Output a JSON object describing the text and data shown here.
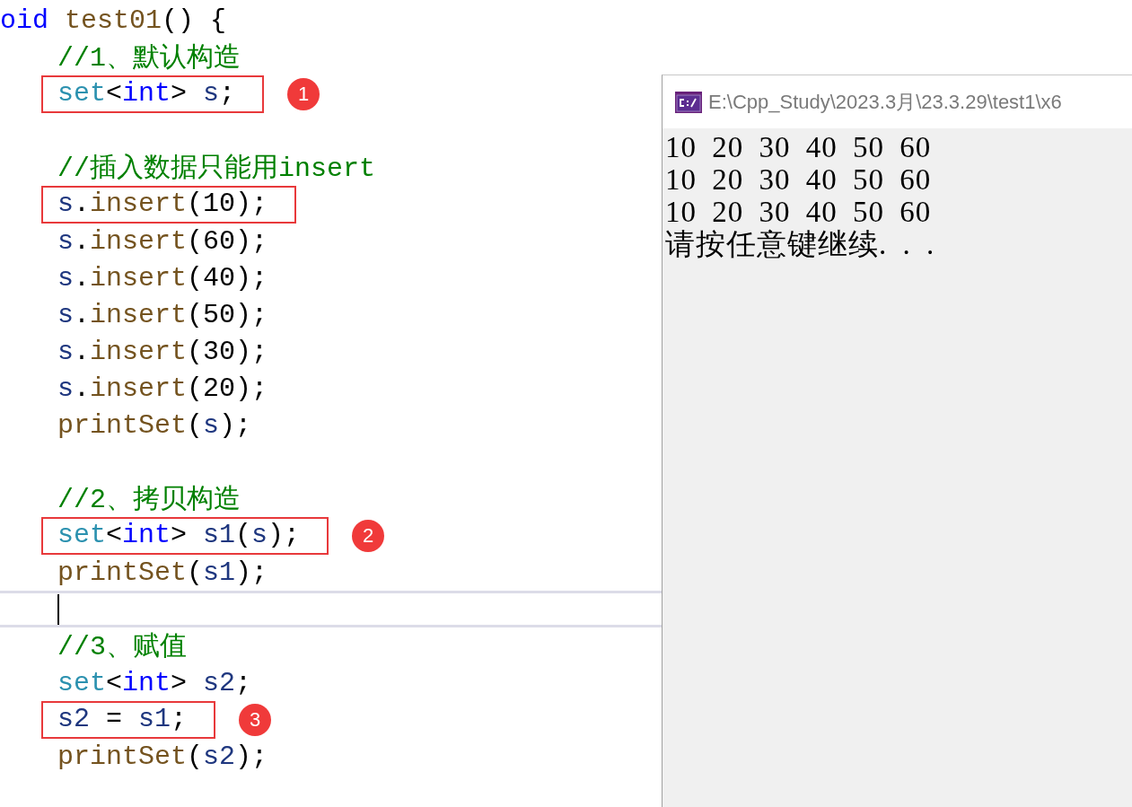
{
  "editor": {
    "lines": [
      {
        "boxed": false,
        "current": false,
        "tokens": [
          {
            "kind": "keyword",
            "text": "oid"
          },
          {
            "kind": "function",
            "text": " test01"
          },
          {
            "kind": "plain",
            "text": "() {"
          }
        ]
      },
      {
        "boxed": false,
        "current": false,
        "tokens": [
          {
            "kind": "comment",
            "text": "//1、默认构造"
          }
        ]
      },
      {
        "boxed": true,
        "current": false,
        "badge": "1",
        "tokens": [
          {
            "kind": "type",
            "text": "set"
          },
          {
            "kind": "plain",
            "text": "<"
          },
          {
            "kind": "keyword",
            "text": "int"
          },
          {
            "kind": "plain",
            "text": "> "
          },
          {
            "kind": "variable",
            "text": "s"
          },
          {
            "kind": "plain",
            "text": ";"
          }
        ]
      },
      {
        "current": false
      },
      {
        "boxed": false,
        "current": false,
        "tokens": [
          {
            "kind": "comment",
            "text": "//插入数据只能用insert"
          }
        ]
      },
      {
        "boxed": true,
        "current": false,
        "tokens": [
          {
            "kind": "variable",
            "text": "s"
          },
          {
            "kind": "plain",
            "text": "."
          },
          {
            "kind": "function",
            "text": "insert"
          },
          {
            "kind": "plain",
            "text": "(10);"
          }
        ]
      },
      {
        "boxed": false,
        "current": false,
        "tokens": [
          {
            "kind": "variable",
            "text": "s"
          },
          {
            "kind": "plain",
            "text": "."
          },
          {
            "kind": "function",
            "text": "insert"
          },
          {
            "kind": "plain",
            "text": "(60);"
          }
        ]
      },
      {
        "boxed": false,
        "current": false,
        "tokens": [
          {
            "kind": "variable",
            "text": "s"
          },
          {
            "kind": "plain",
            "text": "."
          },
          {
            "kind": "function",
            "text": "insert"
          },
          {
            "kind": "plain",
            "text": "(40);"
          }
        ]
      },
      {
        "boxed": false,
        "current": false,
        "tokens": [
          {
            "kind": "variable",
            "text": "s"
          },
          {
            "kind": "plain",
            "text": "."
          },
          {
            "kind": "function",
            "text": "insert"
          },
          {
            "kind": "plain",
            "text": "(50);"
          }
        ]
      },
      {
        "boxed": false,
        "current": false,
        "tokens": [
          {
            "kind": "variable",
            "text": "s"
          },
          {
            "kind": "plain",
            "text": "."
          },
          {
            "kind": "function",
            "text": "insert"
          },
          {
            "kind": "plain",
            "text": "(30);"
          }
        ]
      },
      {
        "boxed": false,
        "current": false,
        "tokens": [
          {
            "kind": "variable",
            "text": "s"
          },
          {
            "kind": "plain",
            "text": "."
          },
          {
            "kind": "function",
            "text": "insert"
          },
          {
            "kind": "plain",
            "text": "(20);"
          }
        ]
      },
      {
        "boxed": false,
        "current": false,
        "tokens": [
          {
            "kind": "function",
            "text": "printSet"
          },
          {
            "kind": "plain",
            "text": "("
          },
          {
            "kind": "variable",
            "text": "s"
          },
          {
            "kind": "plain",
            "text": ");"
          }
        ]
      },
      {
        "current": false
      },
      {
        "boxed": false,
        "current": false,
        "tokens": [
          {
            "kind": "comment",
            "text": "//2、拷贝构造"
          }
        ]
      },
      {
        "boxed": true,
        "current": false,
        "badge": "2",
        "tokens": [
          {
            "kind": "type",
            "text": "set"
          },
          {
            "kind": "plain",
            "text": "<"
          },
          {
            "kind": "keyword",
            "text": "int"
          },
          {
            "kind": "plain",
            "text": "> "
          },
          {
            "kind": "variable",
            "text": "s1"
          },
          {
            "kind": "plain",
            "text": "("
          },
          {
            "kind": "variable",
            "text": "s"
          },
          {
            "kind": "plain",
            "text": ");"
          }
        ]
      },
      {
        "boxed": false,
        "current": false,
        "tokens": [
          {
            "kind": "function",
            "text": "printSet"
          },
          {
            "kind": "plain",
            "text": "("
          },
          {
            "kind": "variable",
            "text": "s1"
          },
          {
            "kind": "plain",
            "text": ");"
          }
        ]
      },
      {
        "current": true
      },
      {
        "boxed": false,
        "current": false,
        "tokens": [
          {
            "kind": "comment",
            "text": "//3、赋值"
          }
        ]
      },
      {
        "boxed": false,
        "current": false,
        "tokens": [
          {
            "kind": "type",
            "text": "set"
          },
          {
            "kind": "plain",
            "text": "<"
          },
          {
            "kind": "keyword",
            "text": "int"
          },
          {
            "kind": "plain",
            "text": "> "
          },
          {
            "kind": "variable",
            "text": "s2"
          },
          {
            "kind": "plain",
            "text": ";"
          }
        ]
      },
      {
        "boxed": true,
        "current": false,
        "badge": "3",
        "tokens": [
          {
            "kind": "variable",
            "text": "s2"
          },
          {
            "kind": "plain",
            "text": " = "
          },
          {
            "kind": "variable",
            "text": "s1"
          },
          {
            "kind": "plain",
            "text": ";"
          }
        ]
      },
      {
        "boxed": false,
        "current": false,
        "tokens": [
          {
            "kind": "function",
            "text": "printSet"
          },
          {
            "kind": "plain",
            "text": "("
          },
          {
            "kind": "variable",
            "text": "s2"
          },
          {
            "kind": "plain",
            "text": ");"
          }
        ]
      }
    ]
  },
  "console": {
    "title": "E:\\Cpp_Study\\2023.3月\\23.3.29\\test1\\x6",
    "output": [
      "10 20 30 40 50 60",
      "10 20 30 40 50 60",
      "10 20 30 40 50 60",
      "请按任意键继续. . ."
    ]
  }
}
